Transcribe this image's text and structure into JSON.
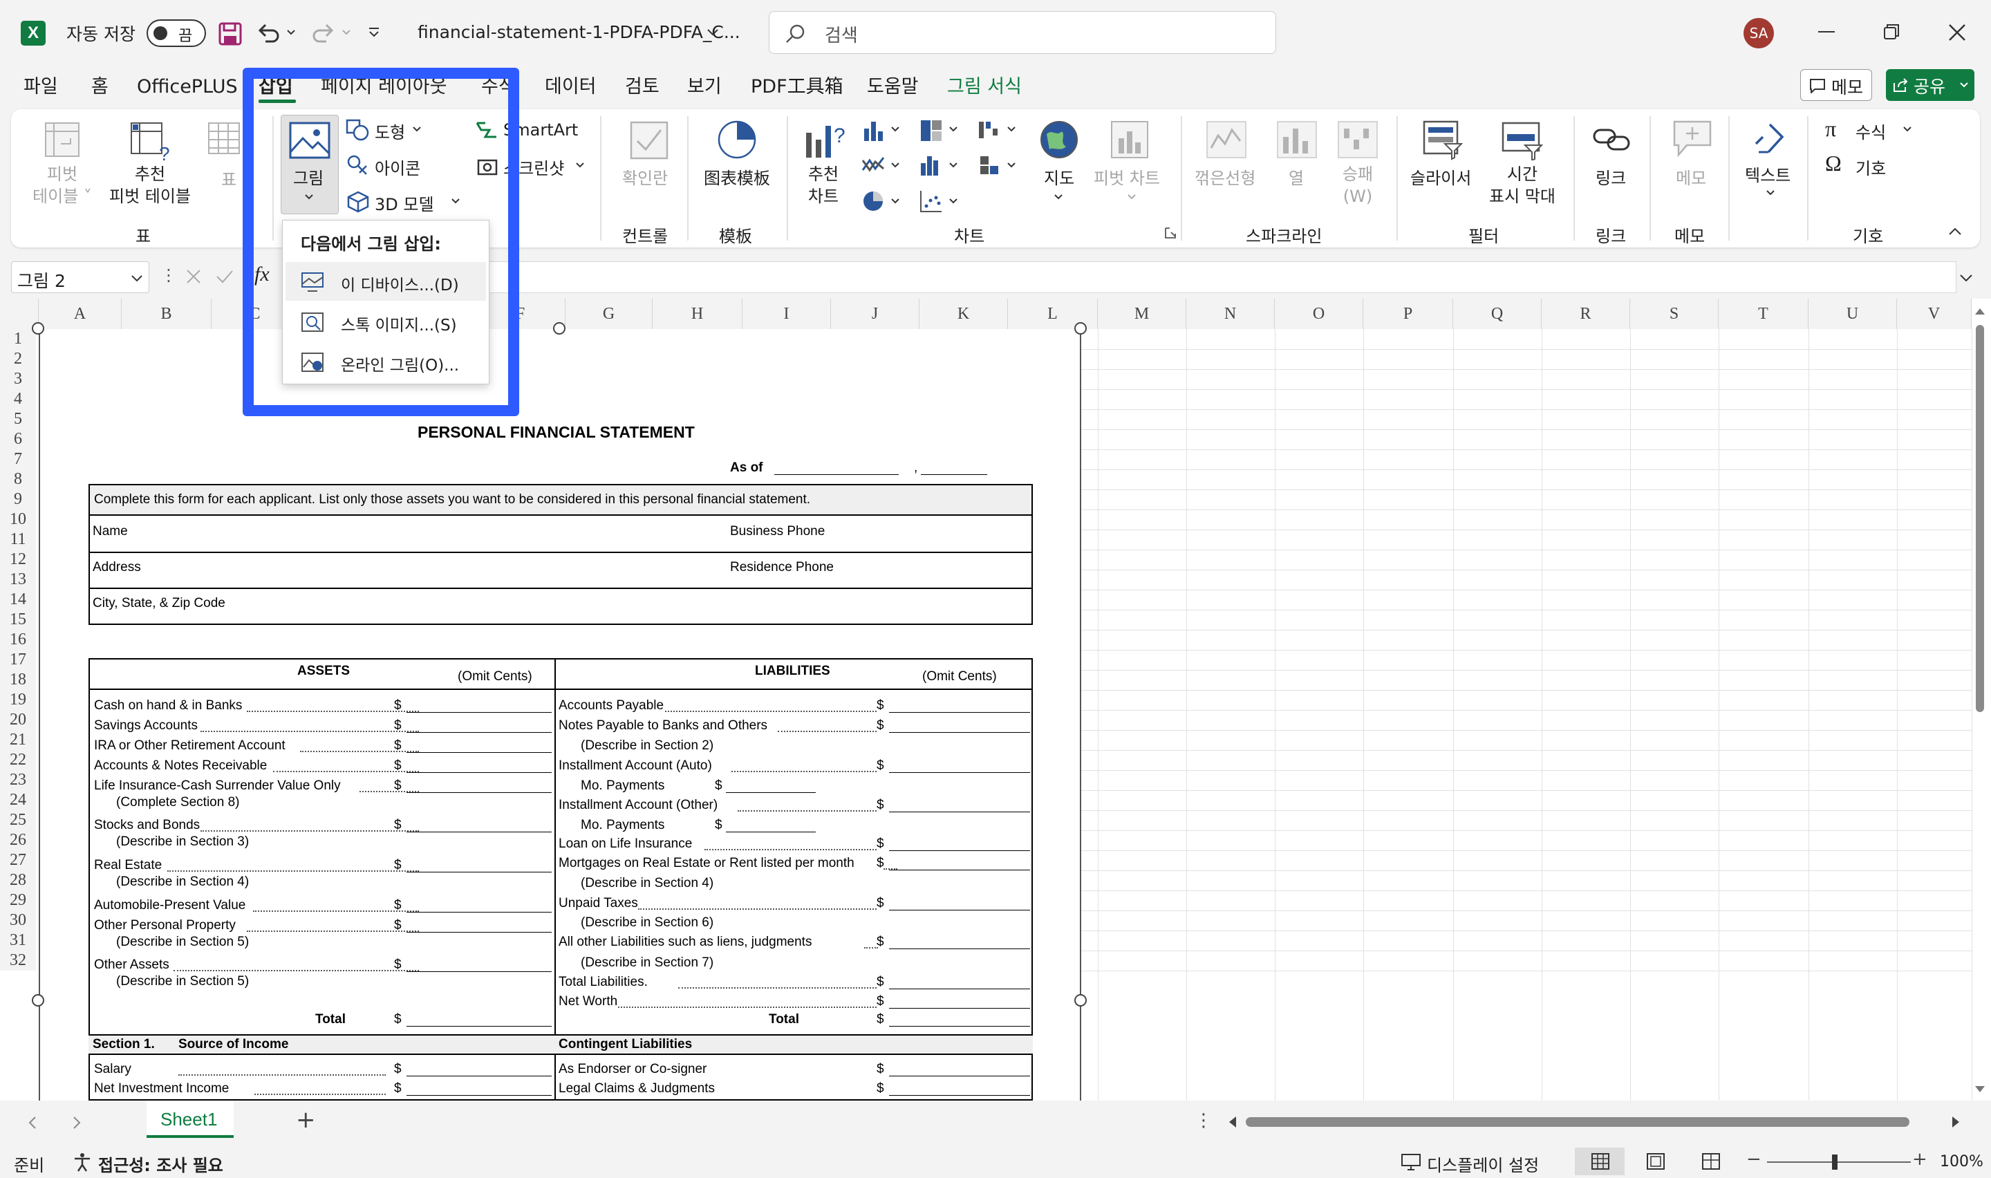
{
  "titlebar": {
    "autosave_label": "자동 저장",
    "autosave_state": "끔",
    "filename": "financial-statement-1-PDFA-PDFA_C...",
    "search_placeholder": "검색",
    "avatar": "SA"
  },
  "menu": {
    "tabs": [
      "파일",
      "홈",
      "OfficePLUS",
      "삽입",
      "페이지 레이아웃",
      "수식",
      "데이터",
      "검토",
      "보기",
      "PDF工具箱",
      "도움말",
      "그림 서식"
    ],
    "active": "삽입",
    "comment_btn": "메모",
    "share_btn": "공유"
  },
  "ribbon": {
    "table_group": {
      "label": "표",
      "pivot": [
        "피벗",
        "테이블"
      ],
      "recommended_pivot": [
        "추천",
        "피벗 테이블"
      ],
      "table": "표"
    },
    "illust": {
      "picture": "그림",
      "shapes": "도형",
      "icons": "아이콘",
      "models3d": "3D 모델",
      "smartart": "SmartArt",
      "screenshot": "스크린샷"
    },
    "controls": {
      "label": "컨트롤",
      "checkbox": "확인란"
    },
    "template": {
      "label": "模板",
      "item": "图表模板"
    },
    "charts": {
      "label": "차트",
      "recommended": [
        "추천",
        "차트"
      ],
      "map": "지도",
      "pivotchart": "피벗 차트"
    },
    "sparkline": {
      "label": "스파크라인",
      "line": "꺾은선형",
      "column": "열",
      "winloss": [
        "승패",
        "(W)"
      ]
    },
    "filter": {
      "label": "필터",
      "slicer": "슬라이서",
      "timeline": [
        "시간",
        "표시 막대"
      ]
    },
    "link": {
      "label": "링크",
      "item": "링크"
    },
    "comment": {
      "label": "메모",
      "item": "메모"
    },
    "text": {
      "item": "텍스트"
    },
    "symbols": {
      "label": "기호",
      "equation": "수식",
      "symbol": "기호"
    }
  },
  "dropdown": {
    "title": "다음에서 그림 삽입:",
    "items": [
      "이 디바이스...(D)",
      "스톡 이미지...(S)",
      "온라인 그림(O)..."
    ]
  },
  "formula": {
    "namebox": "그림 2",
    "fx": "fx"
  },
  "columns": [
    "A",
    "B",
    "C",
    "D",
    "E",
    "F",
    "G",
    "H",
    "I",
    "J",
    "K",
    "L",
    "M",
    "N",
    "O",
    "P",
    "Q",
    "R",
    "S",
    "T",
    "U",
    "V"
  ],
  "rows": [
    "1",
    "2",
    "3",
    "4",
    "5",
    "6",
    "7",
    "8",
    "9",
    "10",
    "11",
    "12",
    "13",
    "14",
    "15",
    "16",
    "17",
    "18",
    "19",
    "20",
    "21",
    "22",
    "23",
    "24",
    "25",
    "26",
    "27",
    "28",
    "29",
    "30",
    "31",
    "32"
  ],
  "doc": {
    "title": "PERSONAL FINANCIAL STATEMENT",
    "as_of": "As of",
    "comma": ",",
    "instruction": "Complete this form for each applicant.  List only those assets you want to be considered in this personal financial statement.",
    "name": "Name",
    "business_phone": "Business Phone",
    "address": "Address",
    "residence_phone": "Residence Phone",
    "city": "City, State, & Zip Code",
    "assets": "ASSETS",
    "omit": "(Omit Cents)",
    "liabilities": "LIABILITIES",
    "left_items": [
      "Cash on hand & in Banks",
      "Savings Accounts",
      "IRA or Other Retirement Account",
      "Accounts & Notes Receivable",
      "Life Insurance-Cash Surrender Value Only",
      "(Complete Section 8)",
      "Stocks and Bonds",
      "(Describe in Section 3)",
      "Real Estate",
      "(Describe in Section 4)",
      "Automobile-Present Value",
      "Other Personal Property",
      "(Describe in Section 5)",
      "Other Assets",
      "(Describe in Section 5)",
      "Total"
    ],
    "right_items": [
      "Accounts Payable",
      "Notes Payable to Banks and Others",
      "(Describe in Section 2)",
      "Installment Account (Auto)",
      "Mo. Payments",
      "Installment Account (Other)",
      "Mo. Payments",
      "Loan on Life Insurance",
      "Mortgages on Real Estate or Rent listed per month",
      "(Describe in Section 4)",
      "Unpaid Taxes",
      "(Describe in Section 6)",
      "All other Liabilities such as liens, judgments",
      "(Describe in Section 7)",
      "Total Liabilities.",
      "Net Worth",
      "Total"
    ],
    "section1": "Section 1.",
    "source_income": "Source of Income",
    "contingent": "Contingent Liabilities",
    "salary": "Salary",
    "net_invest": "Net Investment Income",
    "endorser": "As Endorser or Co-signer",
    "legal": "Legal Claims & Judgments",
    "dollar": "$"
  },
  "sheet": {
    "tab": "Sheet1",
    "add": "+"
  },
  "status": {
    "ready": "준비",
    "accessibility": "접근성: 조사 필요",
    "display": "디스플레이 설정",
    "zoom": "100%"
  }
}
